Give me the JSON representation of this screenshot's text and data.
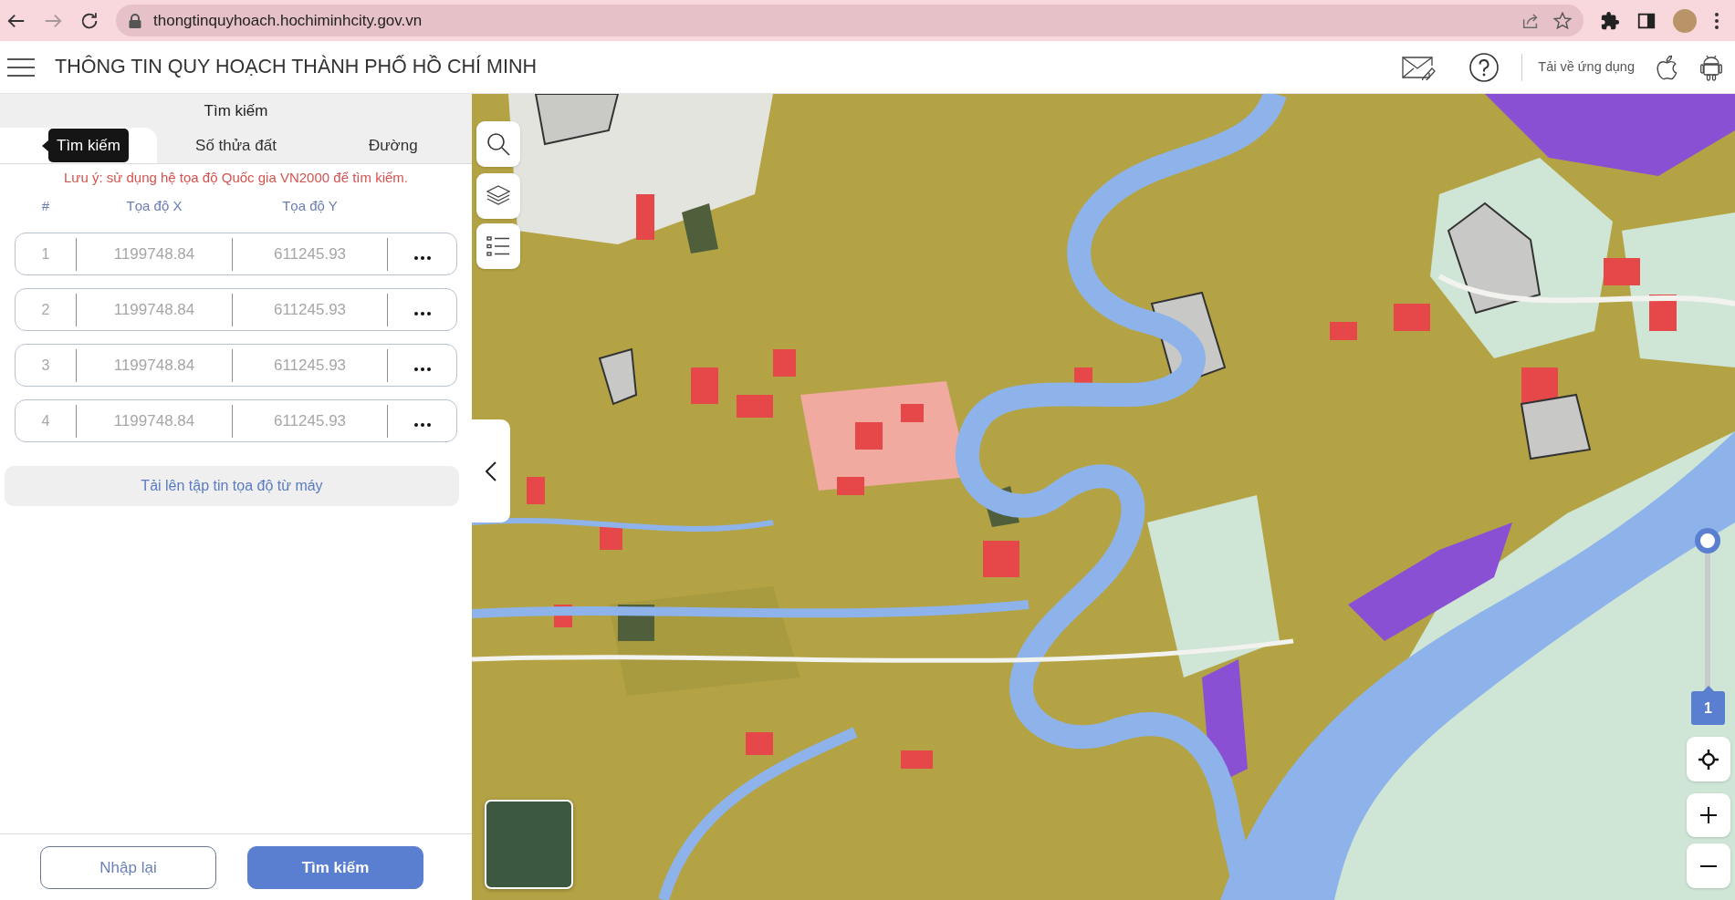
{
  "browser": {
    "url": "thongtinquyhoach.hochiminhcity.gov.vn",
    "forward_disabled": true
  },
  "header": {
    "title": "THÔNG TIN QUY HOẠCH THÀNH PHỐ HỒ CHÍ MINH",
    "download_label": "Tải về ứng dụng"
  },
  "panel": {
    "title": "Tìm kiếm",
    "tabs": [
      {
        "selected": true
      },
      {
        "label": "Số thửa đất",
        "selected": false
      },
      {
        "label": "Đường",
        "selected": false
      }
    ],
    "tooltip": "Tìm kiếm",
    "note": "Lưu ý: sử dụng hệ tọa độ Quốc gia VN2000 để tìm kiếm.",
    "columns": [
      "#",
      "Tọa độ X",
      "Tọa độ Y"
    ],
    "rows": [
      {
        "number": "1",
        "x": {
          "placeholder": "1199748.84"
        },
        "y": {
          "placeholder": "611245.93"
        }
      },
      {
        "number": "2",
        "x": {
          "placeholder": "1199748.84"
        },
        "y": {
          "placeholder": "611245.93"
        }
      },
      {
        "number": "3",
        "x": {
          "placeholder": "1199748.84"
        },
        "y": {
          "placeholder": "611245.93"
        }
      },
      {
        "number": "4",
        "x": {
          "placeholder": "1199748.84"
        },
        "y": {
          "placeholder": "611245.93"
        }
      }
    ],
    "upload_label": "Tải lên tập tin tọa độ từ máy",
    "buttons": [
      {
        "kind": "outline",
        "label": "Nhập lại"
      },
      {
        "kind": "primary",
        "label": "Tìm kiếm"
      }
    ]
  },
  "map": {
    "opacity_slider": {
      "level": 1,
      "reading": "1"
    }
  }
}
